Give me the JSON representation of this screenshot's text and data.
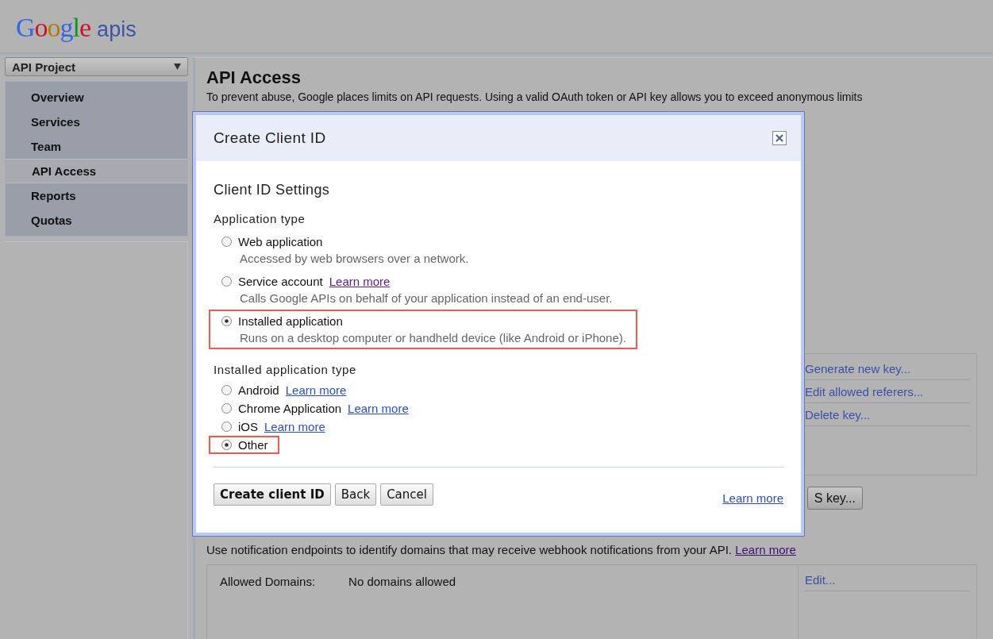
{
  "header": {
    "logo": "Google",
    "product": "apis"
  },
  "project_selector": {
    "value": "API Project"
  },
  "sidebar": {
    "items": [
      {
        "label": "Overview",
        "selected": false
      },
      {
        "label": "Services",
        "selected": false
      },
      {
        "label": "Team",
        "selected": false
      },
      {
        "label": "API Access",
        "selected": true
      },
      {
        "label": "Reports",
        "selected": false
      },
      {
        "label": "Quotas",
        "selected": false
      }
    ]
  },
  "page": {
    "title": "API Access",
    "intro": "To prevent abuse, Google places limits on API requests. Using a valid OAuth token or API key allows you to exceed anonymous limits",
    "key_actions": [
      "Generate new key...",
      "Edit allowed referers...",
      "Delete key..."
    ],
    "partial_button": "S key...",
    "notification": {
      "text": "Use notification endpoints to identify domains that may receive webhook notifications from your API.",
      "link": {
        "text": "Learn more",
        "visited": true
      }
    },
    "domains": {
      "label": "Allowed Domains:",
      "value": "No domains allowed",
      "action": "Edit..."
    }
  },
  "dialog": {
    "title": "Create Client ID",
    "section": "Client ID Settings",
    "application_type": {
      "label": "Application type",
      "options": [
        {
          "label": "Web application",
          "description": "Accessed by web browsers over a network.",
          "selected": false,
          "highlighted": false
        },
        {
          "label": "Service account",
          "description": "Calls Google APIs on behalf of your application instead of an end-user.",
          "link": {
            "text": "Learn more",
            "visited": true
          },
          "selected": false,
          "highlighted": false
        },
        {
          "label": "Installed application",
          "description": "Runs on a desktop computer or handheld device (like Android or iPhone).",
          "selected": true,
          "highlighted": true
        }
      ]
    },
    "installed_type": {
      "label": "Installed application type",
      "options": [
        {
          "label": "Android",
          "link": {
            "text": "Learn more",
            "visited": false
          },
          "selected": false,
          "highlighted": false
        },
        {
          "label": "Chrome Application",
          "link": {
            "text": "Learn more",
            "visited": false
          },
          "selected": false,
          "highlighted": false
        },
        {
          "label": "iOS",
          "link": {
            "text": "Learn more",
            "visited": false
          },
          "selected": false,
          "highlighted": false
        },
        {
          "label": "Other",
          "selected": true,
          "highlighted": true
        }
      ]
    },
    "buttons": [
      {
        "label": "Create client ID",
        "primary": true
      },
      {
        "label": "Back",
        "primary": false
      },
      {
        "label": "Cancel",
        "primary": false
      }
    ],
    "footer_link": {
      "text": "Learn more",
      "visited": false
    }
  }
}
